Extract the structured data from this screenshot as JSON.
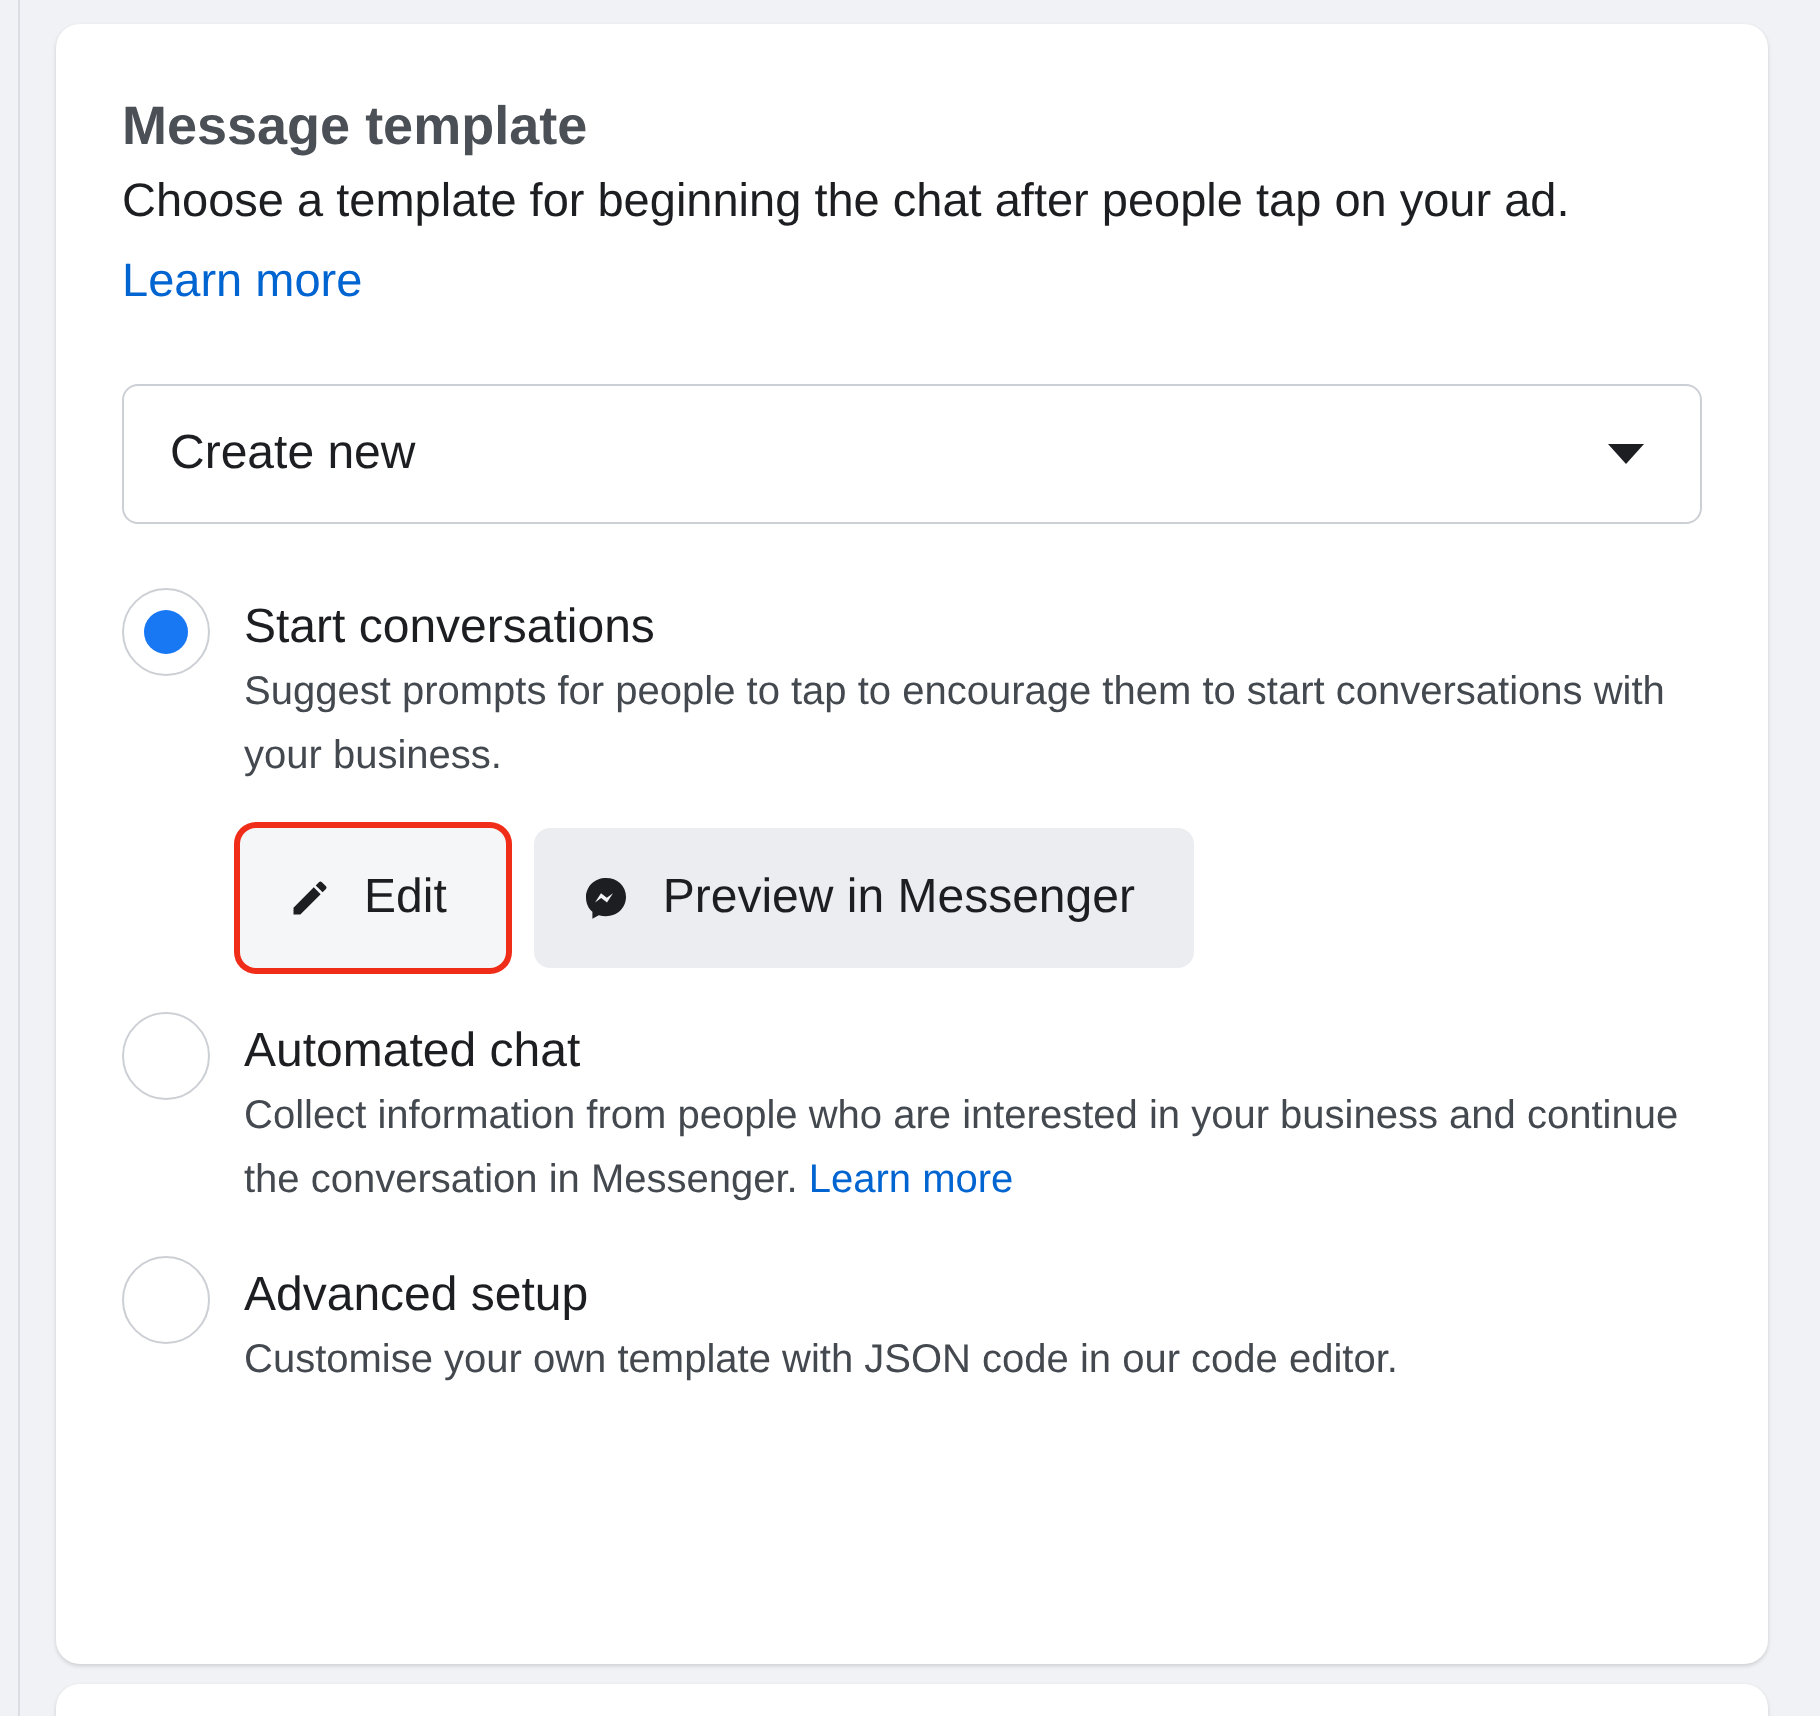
{
  "card": {
    "title": "Message template",
    "description": {
      "text": "Choose a template for beginning the chat after people tap on your ad.",
      "link": "Learn more"
    },
    "dropdown": {
      "value": "Create new"
    },
    "options": [
      {
        "title": "Start conversations",
        "description": "Suggest prompts for people to tap to encourage them to start conversations with your business.",
        "selected": true,
        "buttons": [
          {
            "kind": "edit",
            "label": "Edit",
            "highlighted": true
          },
          {
            "kind": "preview",
            "label": "Preview in Messenger",
            "highlighted": false
          }
        ]
      },
      {
        "title": "Automated chat",
        "description": "Collect information from people who are interested in your business and continue the conversation in Messenger.",
        "link": "Learn more",
        "selected": false
      },
      {
        "title": "Advanced setup",
        "description": "Customise your own template with JSON code in our code editor.",
        "selected": false
      }
    ]
  }
}
